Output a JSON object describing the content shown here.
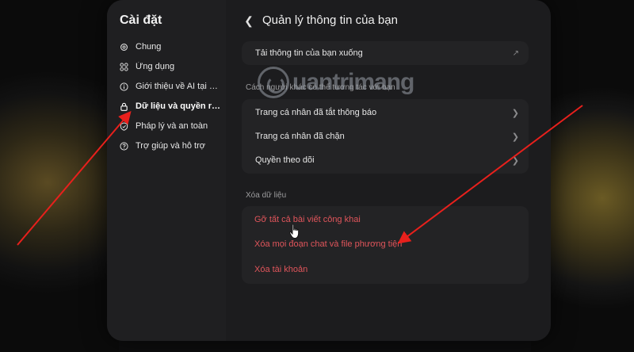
{
  "sidebar": {
    "title": "Cài đặt",
    "items": [
      {
        "label": "Chung",
        "icon": "gear-icon"
      },
      {
        "label": "Ứng dụng",
        "icon": "apps-grid-icon"
      },
      {
        "label": "Giới thiệu về AI tại M...",
        "icon": "info-icon"
      },
      {
        "label": "Dữ liệu và quyền riê...",
        "icon": "lock-icon",
        "active": true
      },
      {
        "label": "Pháp lý và an toàn",
        "icon": "shield-check-icon"
      },
      {
        "label": "Trợ giúp và hỗ trợ",
        "icon": "help-circle-icon"
      }
    ]
  },
  "header": {
    "back_icon": "chevron-left-icon",
    "title": "Quản lý thông tin của bạn",
    "close_icon": "close-icon"
  },
  "download": {
    "label": "Tải thông tin của bạn xuống",
    "icon": "external-arrow-icon"
  },
  "others_section": {
    "label": "Cách người khác có thể tương tác với bạn",
    "items": [
      {
        "label": "Trang cá nhân đã tắt thông báo"
      },
      {
        "label": "Trang cá nhân đã chặn"
      },
      {
        "label": "Quyền theo dõi"
      }
    ]
  },
  "delete_section": {
    "label": "Xóa dữ liệu",
    "items": [
      {
        "label": "Gỡ tất cả bài viết công khai"
      },
      {
        "label": "Xóa mọi đoạn chat và file phương tiện"
      },
      {
        "label": "Xóa tài khoản"
      }
    ]
  },
  "watermark": {
    "text": "uantrimang"
  },
  "colors": {
    "danger": "#e0555b",
    "background": "#1c1c1e",
    "annotation_arrow": "#e8201c"
  }
}
